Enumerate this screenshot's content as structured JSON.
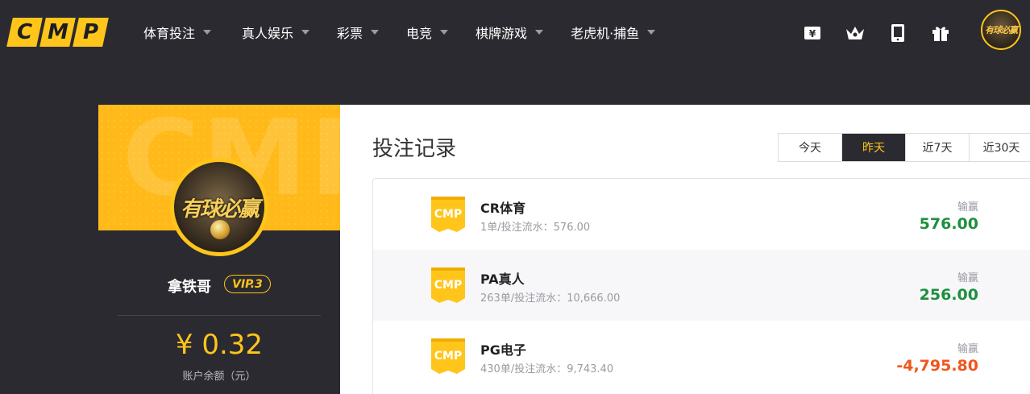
{
  "brand": {
    "logo_letters": [
      "C",
      "M",
      "P"
    ],
    "accent": "#ffc51a"
  },
  "nav": [
    {
      "label": "体育投注"
    },
    {
      "label": "真人娱乐"
    },
    {
      "label": "彩票"
    },
    {
      "label": "电竞"
    },
    {
      "label": "棋牌游戏"
    },
    {
      "label": "老虎机·捕鱼"
    }
  ],
  "header_icons": [
    "yen-icon",
    "crown-icon",
    "mobile-icon",
    "gift-icon"
  ],
  "profile": {
    "watermark": "CMP",
    "avatar_text": "有球必赢",
    "username": "拿铁哥",
    "vip": "VIP.3",
    "balance": "¥ 0.32",
    "balance_label": "账户余额（元）"
  },
  "main": {
    "title": "投注记录",
    "ranges": [
      "今天",
      "昨天",
      "近7天",
      "近30天"
    ],
    "active_range": "昨天",
    "records": [
      {
        "badge": "CMP",
        "name": "CR体育",
        "sub": "1单/投注流水：576.00",
        "label": "输赢",
        "amount": "576.00",
        "color": "#1e8f3e"
      },
      {
        "badge": "CMP",
        "name": "PA真人",
        "sub": "263单/投注流水：10,666.00",
        "label": "输赢",
        "amount": "256.00",
        "color": "#1e8f3e"
      },
      {
        "badge": "CMP",
        "name": "PG电子",
        "sub": "430单/投注流水：9,743.40",
        "label": "输赢",
        "amount": "-4,795.80",
        "color": "#f0561d"
      }
    ]
  }
}
